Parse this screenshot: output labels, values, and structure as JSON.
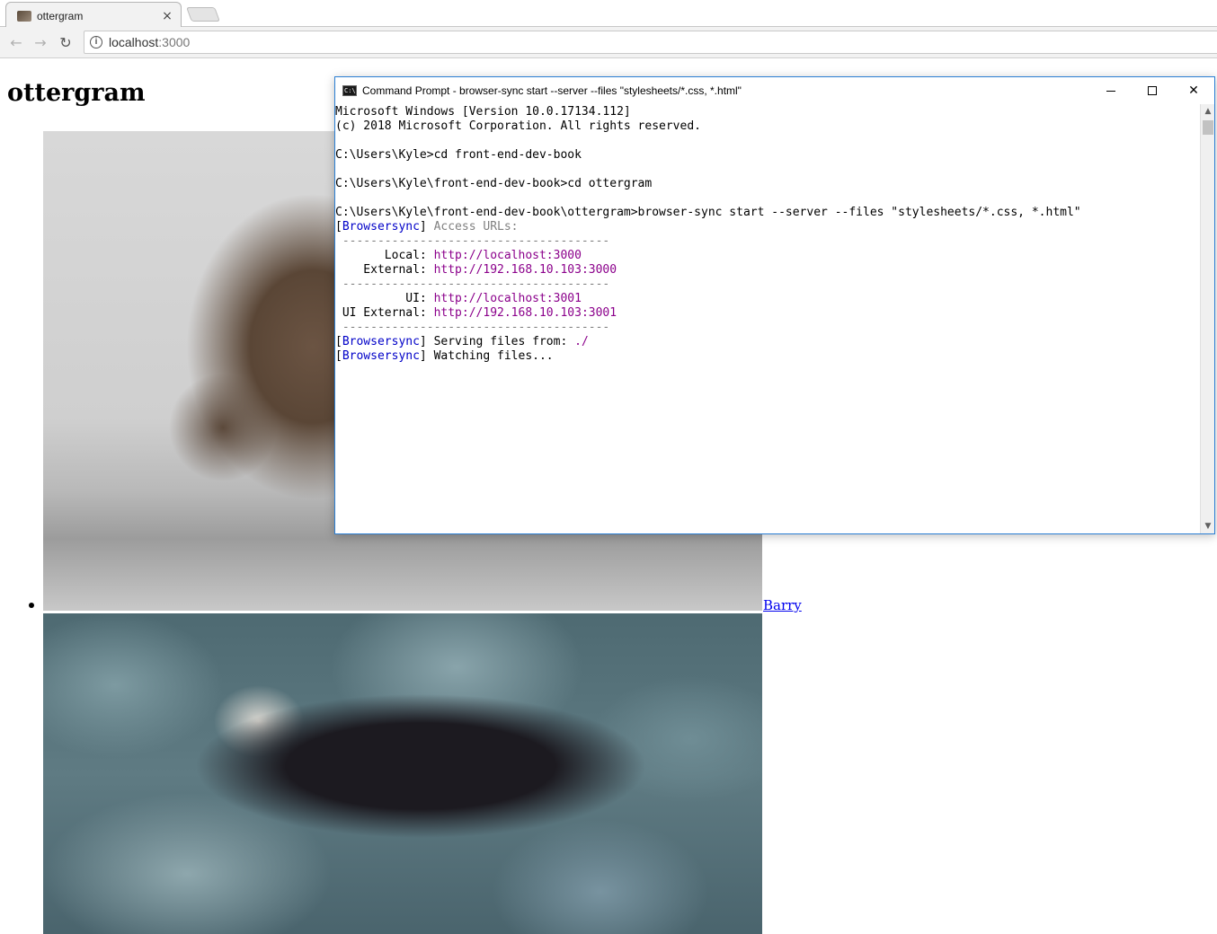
{
  "browser": {
    "tab_title": "ottergram",
    "tab_close": "×",
    "url_host": "localhost",
    "url_port": ":3000",
    "back_icon": "←",
    "forward_icon": "→",
    "reload_icon": "↻",
    "info_icon": "i"
  },
  "page": {
    "heading": "ottergram",
    "items": [
      {
        "caption": "Barry"
      }
    ]
  },
  "cmd": {
    "title": "Command Prompt - browser-sync  start --server --files \"stylesheets/*.css, *.html\"",
    "icon_text": "C:\\",
    "close_icon": "✕",
    "scroll_up": "▲",
    "scroll_down": "▼",
    "lines": {
      "l1": "Microsoft Windows [Version 10.0.17134.112]",
      "l2": "(c) 2018 Microsoft Corporation. All rights reserved.",
      "l3": "C:\\Users\\Kyle>cd front-end-dev-book",
      "l4": "C:\\Users\\Kyle\\front-end-dev-book>cd ottergram",
      "l5": "C:\\Users\\Kyle\\front-end-dev-book\\ottergram>browser-sync start --server --files \"stylesheets/*.css, *.html\"",
      "bs_tag": "Browsersync",
      "access_urls": "Access URLs:",
      "divider": " --------------------------------------",
      "local_label": "       Local: ",
      "local_url": "http://localhost:3000",
      "external_label": "    External: ",
      "external_url": "http://192.168.10.103:3000",
      "ui_label": "          UI: ",
      "ui_url": "http://localhost:3001",
      "ui_external_label": " UI External: ",
      "ui_external_url": "http://192.168.10.103:3001",
      "serving": " Serving files from: ",
      "serving_path": "./",
      "watching": " Watching files..."
    }
  }
}
